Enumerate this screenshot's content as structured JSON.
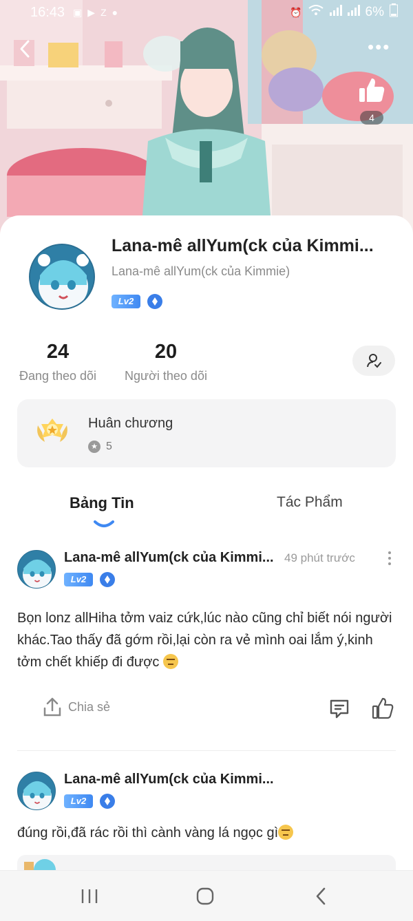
{
  "status_bar": {
    "time": "16:43",
    "left_icons": [
      "gallery-icon",
      "youtube-icon",
      "zalo-icon",
      "dot-icon"
    ],
    "right_icons": [
      "alarm-icon",
      "wifi-icon",
      "signal-icon",
      "signal-icon"
    ],
    "battery": "6%"
  },
  "header": {
    "like_count": "4",
    "more_label": "•••"
  },
  "profile": {
    "display_name": "Lana-mê allYum(ck của Kimmi...",
    "full_name": "Lana-mê allYum(ck của Kimmie)",
    "level": "Lv2",
    "following_count": "24",
    "following_label": "Đang theo dõi",
    "followers_count": "20",
    "followers_label": "Người theo dõi"
  },
  "medals": {
    "title": "Huân chương",
    "count": "5"
  },
  "tabs": [
    {
      "label": "Bảng Tin",
      "active": true
    },
    {
      "label": "Tác Phẩm",
      "active": false
    }
  ],
  "posts": [
    {
      "author": "Lana-mê allYum(ck của Kimmi...",
      "level": "Lv2",
      "time": "49 phút trước",
      "text": "Bọn lonz allHiha tởm vaiz cứk,lúc nào cũng chỉ biết nói người khác.Tao thấy đã gớm rồi,lại còn ra vẻ mình oai lắm ý,kinh tởm chết khiếp đi được",
      "emoji": "unamused-face-emoji",
      "share_label": "Chia sẻ"
    },
    {
      "author": "Lana-mê allYum(ck của Kimmi...",
      "level": "Lv2",
      "text": "đúng rồi,đã rác rồi thì cành vàng lá ngọc gì",
      "emoji": "smirking-face-emoji"
    }
  ],
  "colors": {
    "accent_blue": "#3f89f2",
    "level_badge": "#6fb2ff",
    "text_primary": "#222222",
    "text_secondary": "#8a8a8a",
    "card_bg": "#f4f4f5"
  }
}
